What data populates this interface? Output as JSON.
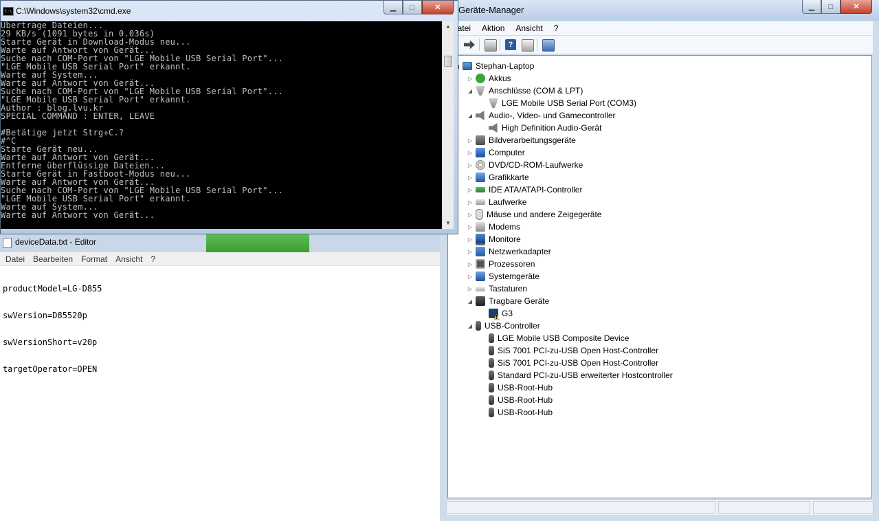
{
  "cmd": {
    "title": "C:\\Windows\\system32\\cmd.exe",
    "icon_text": "C:\\",
    "lines": [
      "Übertrage Dateien...",
      "29 KB/s (1091 bytes in 0.036s)",
      "Starte Gerät in Download-Modus neu...",
      "Warte auf Antwort von Gerät...",
      "Suche nach COM-Port von \"LGE Mobile USB Serial Port\"...",
      "\"LGE Mobile USB Serial Port\" erkannt.",
      "Warte auf System...",
      "Warte auf Antwort von Gerät...",
      "Suche nach COM-Port von \"LGE Mobile USB Serial Port\"...",
      "\"LGE Mobile USB Serial Port\" erkannt.",
      "Author : blog.lvu.kr",
      "SPECIAL COMMAND : ENTER, LEAVE",
      "",
      "#Betätige jetzt Strg+C.?",
      "#^C",
      "Starte Gerät neu...",
      "Warte auf Antwort von Gerät...",
      "Entferne überflüssige Dateien...",
      "Starte Gerät in Fastboot-Modus neu...",
      "Warte auf Antwort von Gerät...",
      "Suche nach COM-Port von \"LGE Mobile USB Serial Port\"...",
      "\"LGE Mobile USB Serial Port\" erkannt.",
      "Warte auf System...",
      "Warte auf Antwort von Gerät..."
    ]
  },
  "editor": {
    "title": "deviceData.txt - Editor",
    "menu": [
      "Datei",
      "Bearbeiten",
      "Format",
      "Ansicht",
      "?"
    ],
    "lines": [
      "productModel=LG-D855",
      "swVersion=D85520p",
      "swVersionShort=v20p",
      "targetOperator=OPEN"
    ]
  },
  "devmgr": {
    "title": "Geräte-Manager",
    "menu": [
      "Datei",
      "Aktion",
      "Ansicht",
      "?"
    ],
    "tree": [
      {
        "level": 0,
        "exp": "open",
        "icon": "root",
        "label": "Stephan-Laptop"
      },
      {
        "level": 1,
        "exp": "closed",
        "icon": "bat",
        "label": "Akkus"
      },
      {
        "level": 1,
        "exp": "open",
        "icon": "port",
        "label": "Anschlüsse (COM & LPT)"
      },
      {
        "level": 2,
        "exp": "none",
        "icon": "port",
        "label": "LGE Mobile USB Serial Port (COM3)"
      },
      {
        "level": 1,
        "exp": "open",
        "icon": "audio",
        "label": "Audio-, Video- und Gamecontroller"
      },
      {
        "level": 2,
        "exp": "none",
        "icon": "audio",
        "label": "High Definition Audio-Gerät"
      },
      {
        "level": 1,
        "exp": "closed",
        "icon": "cam",
        "label": "Bildverarbeitungsgeräte"
      },
      {
        "level": 1,
        "exp": "closed",
        "icon": "comp",
        "label": "Computer"
      },
      {
        "level": 1,
        "exp": "closed",
        "icon": "disc",
        "label": "DVD/CD-ROM-Laufwerke"
      },
      {
        "level": 1,
        "exp": "closed",
        "icon": "gpu",
        "label": "Grafikkarte"
      },
      {
        "level": 1,
        "exp": "closed",
        "icon": "ide",
        "label": "IDE ATA/ATAPI-Controller"
      },
      {
        "level": 1,
        "exp": "closed",
        "icon": "drive",
        "label": "Laufwerke"
      },
      {
        "level": 1,
        "exp": "closed",
        "icon": "mouse",
        "label": "Mäuse und andere Zeigegeräte"
      },
      {
        "level": 1,
        "exp": "closed",
        "icon": "modem",
        "label": "Modems"
      },
      {
        "level": 1,
        "exp": "closed",
        "icon": "mon",
        "label": "Monitore"
      },
      {
        "level": 1,
        "exp": "closed",
        "icon": "net",
        "label": "Netzwerkadapter"
      },
      {
        "level": 1,
        "exp": "closed",
        "icon": "cpu",
        "label": "Prozessoren"
      },
      {
        "level": 1,
        "exp": "closed",
        "icon": "sys",
        "label": "Systemgeräte"
      },
      {
        "level": 1,
        "exp": "closed",
        "icon": "kbd",
        "label": "Tastaturen"
      },
      {
        "level": 1,
        "exp": "open",
        "icon": "port2",
        "label": "Tragbare Geräte"
      },
      {
        "level": 2,
        "exp": "none",
        "icon": "warn",
        "label": "G3"
      },
      {
        "level": 1,
        "exp": "open",
        "icon": "usb",
        "label": "USB-Controller"
      },
      {
        "level": 2,
        "exp": "none",
        "icon": "usb",
        "label": "LGE Mobile USB Composite Device"
      },
      {
        "level": 2,
        "exp": "none",
        "icon": "usb",
        "label": "SiS 7001 PCI-zu-USB Open Host-Controller"
      },
      {
        "level": 2,
        "exp": "none",
        "icon": "usb",
        "label": "SiS 7001 PCI-zu-USB Open Host-Controller"
      },
      {
        "level": 2,
        "exp": "none",
        "icon": "usb",
        "label": "Standard PCI-zu-USB erweiterter Hostcontroller"
      },
      {
        "level": 2,
        "exp": "none",
        "icon": "usb",
        "label": "USB-Root-Hub"
      },
      {
        "level": 2,
        "exp": "none",
        "icon": "usb",
        "label": "USB-Root-Hub"
      },
      {
        "level": 2,
        "exp": "none",
        "icon": "usb",
        "label": "USB-Root-Hub"
      }
    ]
  },
  "colors": {
    "console_bg": "#000000",
    "console_fg": "#c0c0c0",
    "close_button": "#c5422b",
    "desktop": "#7f93ab"
  }
}
